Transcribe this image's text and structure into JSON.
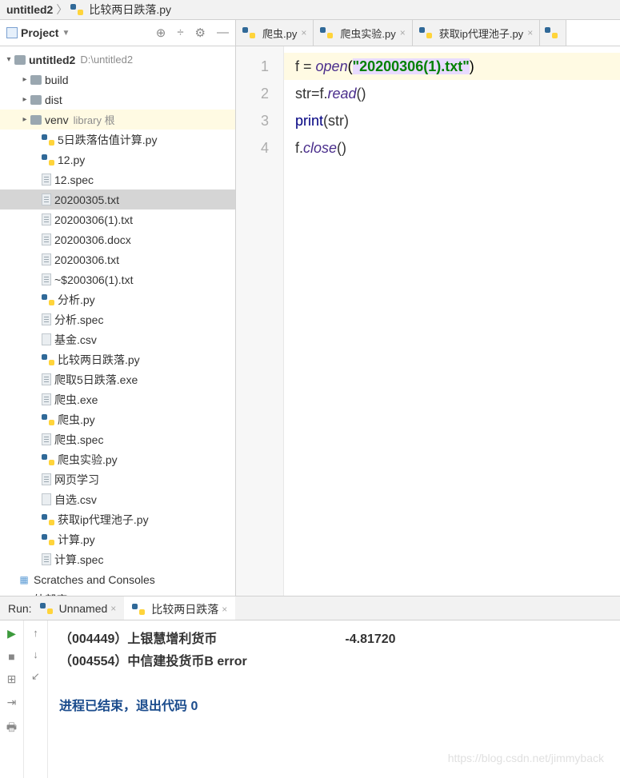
{
  "breadcrumb": {
    "root": "untitled2",
    "file": "比较两日跌落.py"
  },
  "sidebar": {
    "title": "Project",
    "icons": {
      "target": "⊕",
      "collapse": "÷",
      "gear": "⚙",
      "hide": "—"
    },
    "root": {
      "name": "untitled2",
      "path": "D:\\untitled2"
    },
    "folders": [
      {
        "name": "build",
        "expandable": true
      },
      {
        "name": "dist",
        "expandable": true
      },
      {
        "name": "venv",
        "label": "library 根",
        "hl": true,
        "expandable": true
      }
    ],
    "files": [
      {
        "name": "5日跌落估值计算.py",
        "type": "py"
      },
      {
        "name": "12.py",
        "type": "py"
      },
      {
        "name": "12.spec",
        "type": "file"
      },
      {
        "name": "20200305.txt",
        "type": "file",
        "sel": true
      },
      {
        "name": "20200306(1).txt",
        "type": "file"
      },
      {
        "name": "20200306.docx",
        "type": "file"
      },
      {
        "name": "20200306.txt",
        "type": "file"
      },
      {
        "name": "~$200306(1).txt",
        "type": "file"
      },
      {
        "name": "分析.py",
        "type": "py"
      },
      {
        "name": "分析.spec",
        "type": "file"
      },
      {
        "name": "基金.csv",
        "type": "csv"
      },
      {
        "name": "比较两日跌落.py",
        "type": "py"
      },
      {
        "name": "爬取5日跌落.exe",
        "type": "file"
      },
      {
        "name": "爬虫.exe",
        "type": "file"
      },
      {
        "name": "爬虫.py",
        "type": "py"
      },
      {
        "name": "爬虫.spec",
        "type": "file"
      },
      {
        "name": "爬虫实验.py",
        "type": "py"
      },
      {
        "name": "网页学习",
        "type": "file"
      },
      {
        "name": "自选.csv",
        "type": "csv"
      },
      {
        "name": "获取ip代理池子.py",
        "type": "py"
      },
      {
        "name": "计算.py",
        "type": "py"
      },
      {
        "name": "计算.spec",
        "type": "file"
      }
    ],
    "bottom": [
      {
        "name": "Scratches and Consoles",
        "icon": "scratch"
      },
      {
        "name": "外部库",
        "icon": "lib"
      }
    ]
  },
  "tabs": [
    {
      "label": "爬虫.py"
    },
    {
      "label": "爬虫实验.py"
    },
    {
      "label": "获取ip代理池子.py"
    }
  ],
  "code": {
    "lines": [
      "1",
      "2",
      "3",
      "4"
    ],
    "l1": {
      "var": "f",
      "eq": " = ",
      "fn": "open",
      "op": "(",
      "str": "\"20200306(1).txt\"",
      "cp": ")"
    },
    "l2": {
      "a": "str",
      "b": "=f.",
      "fn": "read",
      "p": "()"
    },
    "l3": {
      "fn": "print",
      "op": "(",
      "arg": "str",
      "cp": ")"
    },
    "l4": {
      "a": "f.",
      "fn": "close",
      "p": "()"
    }
  },
  "run": {
    "label": "Run:",
    "tabs": [
      {
        "name": "Unnamed"
      },
      {
        "name": "比较两日跌落"
      }
    ]
  },
  "console": {
    "r1a": "（004449）上银慧增利货币",
    "r1b": "-4.81720",
    "r2": "（004554）中信建投货币B error",
    "exit": "进程已结束，退出代码 0"
  },
  "watermark": "https://blog.csdn.net/jimmyback"
}
